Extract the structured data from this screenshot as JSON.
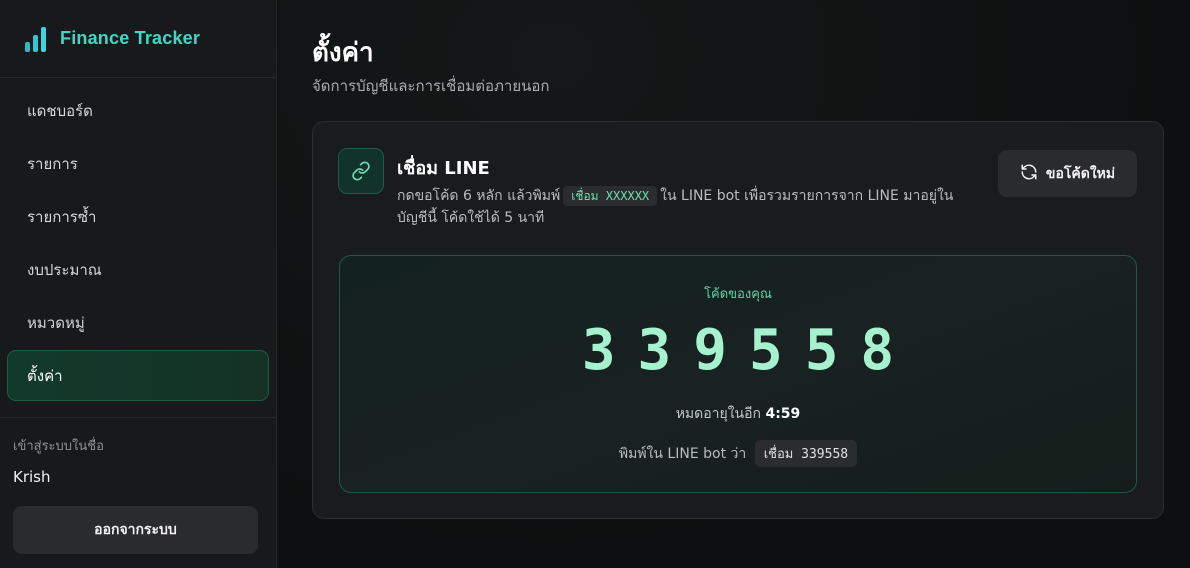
{
  "brand": {
    "title": "Finance Tracker"
  },
  "sidebar": {
    "items": [
      {
        "label": "แดชบอร์ด"
      },
      {
        "label": "รายการ"
      },
      {
        "label": "รายการซ้ำ"
      },
      {
        "label": "งบประมาณ"
      },
      {
        "label": "หมวดหมู่"
      },
      {
        "label": "ตั้งค่า",
        "active": true
      }
    ],
    "login_label": "เข้าสู่ระบบในชื่อ",
    "user_name": "Krish",
    "logout_label": "ออกจากระบบ"
  },
  "page": {
    "title": "ตั้งค่า",
    "subtitle": "จัดการบัญชีและการเชื่อมต่อภายนอก"
  },
  "line_card": {
    "title": "เชื่อม LINE",
    "desc_before": "กดขอโค้ด 6 หลัก แล้วพิมพ์",
    "desc_chip": "เชื่อม XXXXXX",
    "desc_after": "ใน LINE bot เพื่อรวมรายการจาก LINE มาอยู่ในบัญชีนี้ โค้ดใช้ได้ 5 นาที",
    "refresh_label": "ขอโค้ดใหม่",
    "code_label": "โค้ดของคุณ",
    "code": "339558",
    "expire_prefix": "หมดอายุในอีก",
    "expire_time": "4:59",
    "type_prefix": "พิมพ์ใน LINE bot ว่า",
    "type_chip": "เชื่อม 339558"
  },
  "colors": {
    "accent": "#3fd8c8",
    "code": "#a6f2cf",
    "active_bg": "#123a2c"
  },
  "icons": {
    "brand": "bar-chart-icon",
    "link": "link-icon",
    "refresh": "refresh-icon"
  }
}
